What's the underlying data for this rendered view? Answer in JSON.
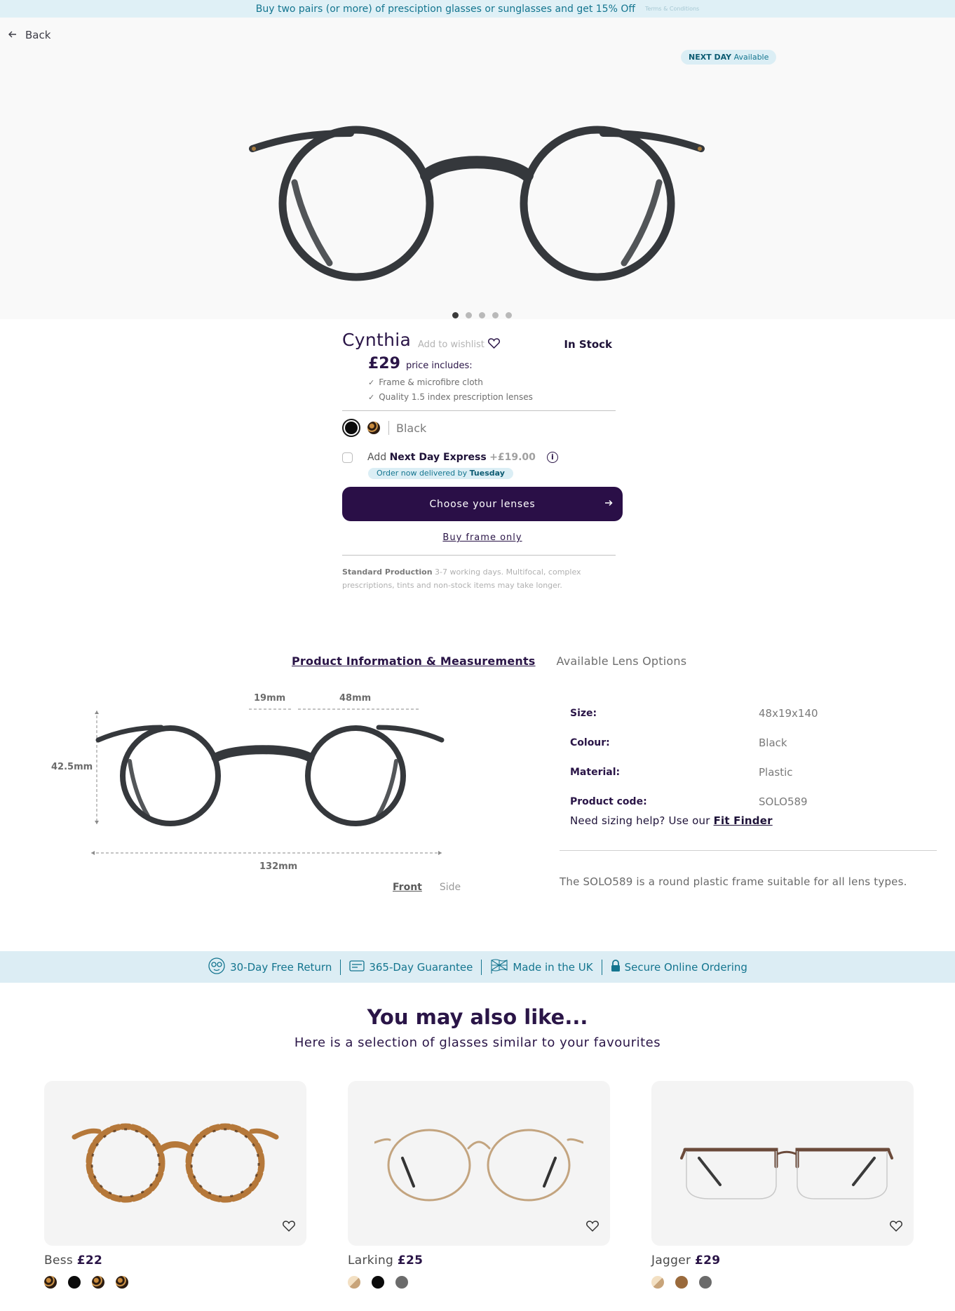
{
  "promo": {
    "text": "Buy two pairs (or more) of presciption glasses or sunglasses and get 15% Off",
    "terms": "Terms & Conditions"
  },
  "hero": {
    "back_label": "Back",
    "next_day_bold": "NEXT DAY",
    "next_day_rest": "Available",
    "slide_count": 5,
    "active_slide": 1
  },
  "product": {
    "name": "Cynthia",
    "wishlist_label": "Add to wishlist",
    "stock": "In Stock",
    "price": "£29",
    "price_includes": "price includes:",
    "includes": [
      "Frame & microfibre cloth",
      "Quality 1.5 index prescription lenses"
    ],
    "colour_selected": "Black",
    "express_prefix": "Add",
    "express_name": "Next Day Express",
    "express_price": "+£19.00",
    "express_checked": false,
    "order_note_prefix": "Order now delivered by",
    "order_note_day": "Tuesday",
    "cta_label": "Choose your lenses",
    "buy_frame_label": "Buy frame only",
    "production_bold": "Standard Production",
    "production_text": "3-7 working days. Multifocal, complex prescriptions, tints and non-stock items may take longer."
  },
  "tabs": [
    {
      "label": "Product Information & Measurements",
      "active": true
    },
    {
      "label": "Available Lens Options",
      "active": false
    }
  ],
  "measurements": {
    "bridge": "19mm",
    "lens": "48mm",
    "height": "42.5mm",
    "width": "132mm",
    "view_front": "Front",
    "view_side": "Side"
  },
  "specs": [
    {
      "key": "Size:",
      "value": "48x19x140"
    },
    {
      "key": "Colour:",
      "value": "Black"
    },
    {
      "key": "Material:",
      "value": "Plastic"
    },
    {
      "key": "Product code:",
      "value": "SOLO589"
    }
  ],
  "sizing_text": "Need sizing help? Use our",
  "sizing_link": "Fit Finder",
  "description": "The SOLO589 is a round plastic frame suitable for all lens types.",
  "trust": [
    "30-Day Free Return",
    "365-Day Guarantee",
    "Made in the UK",
    "Secure Online Ordering"
  ],
  "recommend": {
    "title": "You may also like...",
    "subtitle": "Here is a selection of glasses similar to your favourites",
    "items": [
      {
        "name": "Bess",
        "price": "£22",
        "swatches": [
          "tort",
          "black",
          "tort",
          "tort"
        ]
      },
      {
        "name": "Larking",
        "price": "£25",
        "swatches": [
          "cream",
          "black",
          "grey"
        ]
      },
      {
        "name": "Jagger",
        "price": "£29",
        "swatches": [
          "cream",
          "brown",
          "grey"
        ]
      }
    ]
  },
  "colors": {
    "primary": "#2a0f47",
    "accent": "#14758f",
    "promo_bg": "#dff0f6"
  }
}
